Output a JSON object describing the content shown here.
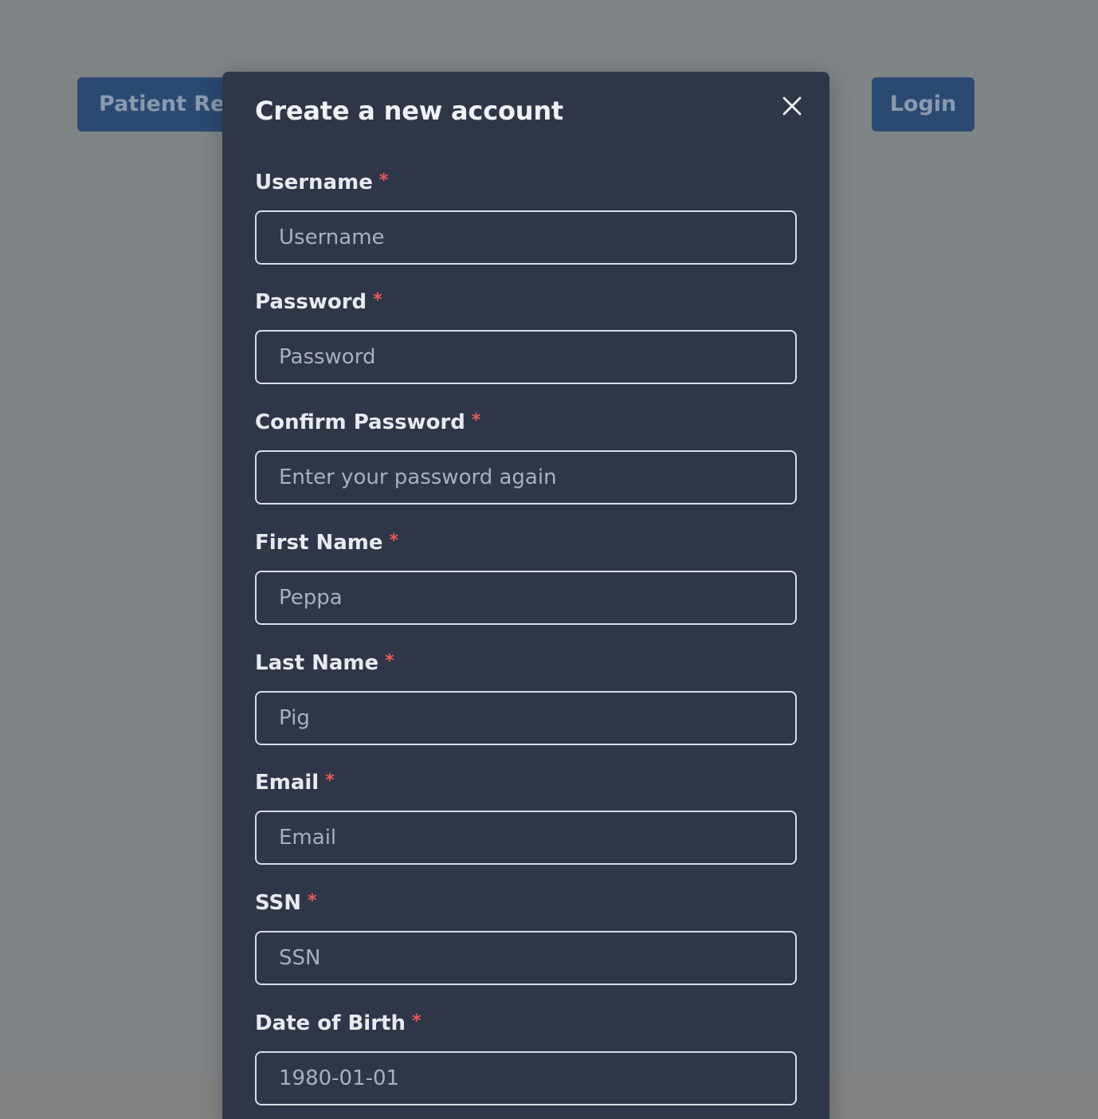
{
  "background": {
    "patient_button_label": "Patient Registration",
    "login_button_label": "Login"
  },
  "modal": {
    "title": "Create a new account",
    "close_icon": "close-icon",
    "required_mark": "*",
    "fields": [
      {
        "label": "Username",
        "placeholder": "Username",
        "type": "text"
      },
      {
        "label": "Password",
        "placeholder": "Password",
        "type": "password"
      },
      {
        "label": "Confirm Password",
        "placeholder": "Enter your password again",
        "type": "password"
      },
      {
        "label": "First Name",
        "placeholder": "Peppa",
        "type": "text"
      },
      {
        "label": "Last Name",
        "placeholder": "Pig",
        "type": "text"
      },
      {
        "label": "Email",
        "placeholder": "Email",
        "type": "email"
      },
      {
        "label": "SSN",
        "placeholder": "SSN",
        "type": "text"
      },
      {
        "label": "Date of Birth",
        "placeholder": "1980-01-01",
        "type": "text"
      }
    ]
  },
  "colors": {
    "backdrop": "#7f8487",
    "modal_background": "#2f3647",
    "button_background": "#2a4a72",
    "required_mark": "#e65a5a"
  }
}
